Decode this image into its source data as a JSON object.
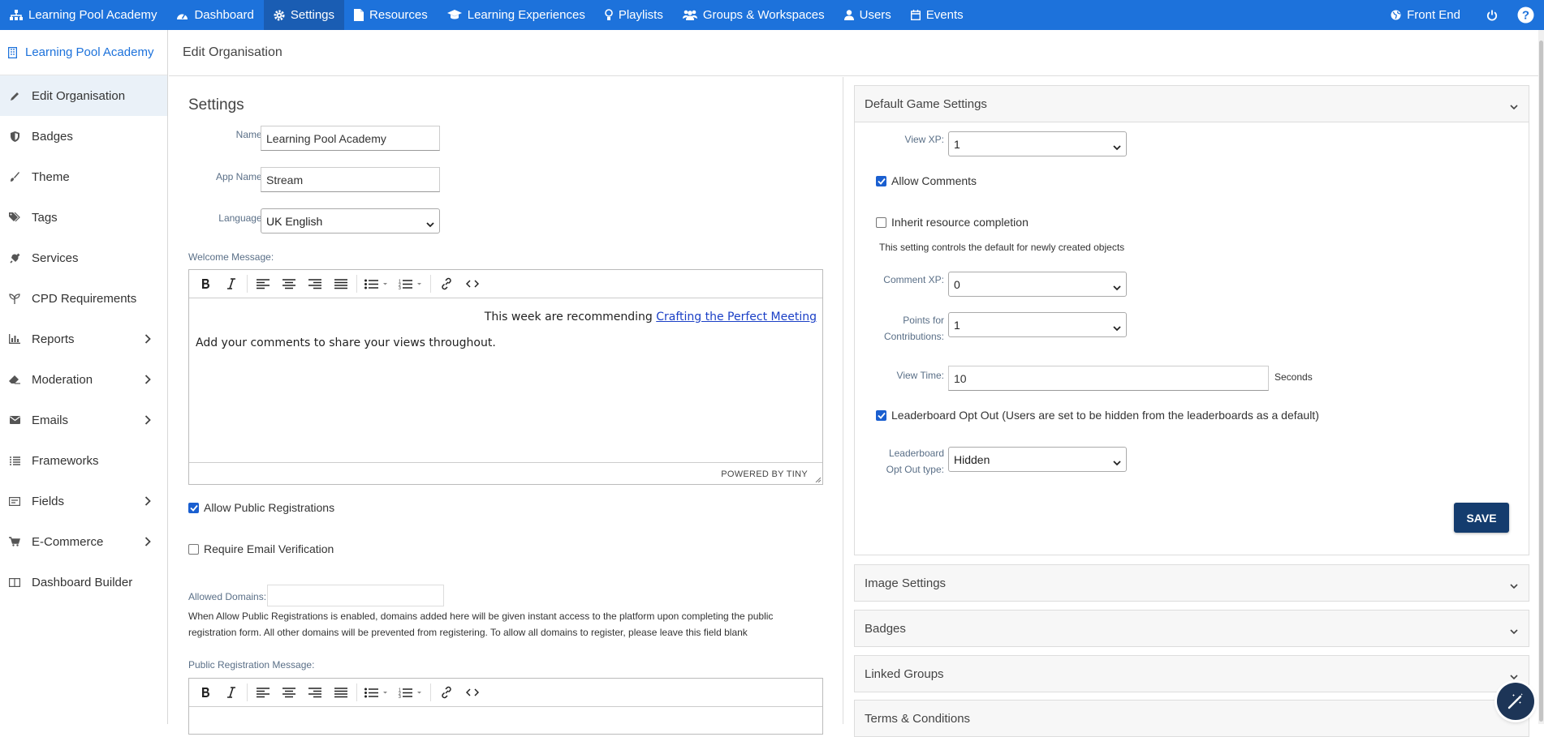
{
  "topnav": {
    "items": [
      {
        "label": "Learning Pool Academy",
        "icon": "sitemap-icon"
      },
      {
        "label": "Dashboard",
        "icon": "dashboard-icon"
      },
      {
        "label": "Settings",
        "icon": "gear-icon"
      },
      {
        "label": "Resources",
        "icon": "file-icon"
      },
      {
        "label": "Learning Experiences",
        "icon": "graduation-cap-icon"
      },
      {
        "label": "Playlists",
        "icon": "lightbulb-icon"
      },
      {
        "label": "Groups & Workspaces",
        "icon": "users-icon"
      },
      {
        "label": "Users",
        "icon": "user-icon"
      },
      {
        "label": "Events",
        "icon": "calendar-icon"
      }
    ],
    "front_end": "Front End",
    "active_color": "#1a5db3",
    "bar_color": "#1d72db"
  },
  "sidebar": {
    "org": "Learning Pool Academy",
    "items": [
      {
        "label": "Edit Organisation",
        "icon": "pencil-icon"
      },
      {
        "label": "Badges",
        "icon": "shield-icon"
      },
      {
        "label": "Theme",
        "icon": "brush-icon"
      },
      {
        "label": "Tags",
        "icon": "tags-icon"
      },
      {
        "label": "Services",
        "icon": "plug-icon"
      },
      {
        "label": "CPD Requirements",
        "icon": "seedling-icon"
      },
      {
        "label": "Reports",
        "icon": "bar-chart-icon"
      },
      {
        "label": "Moderation",
        "icon": "eraser-icon"
      },
      {
        "label": "Emails",
        "icon": "envelope-icon"
      },
      {
        "label": "Frameworks",
        "icon": "list-icon"
      },
      {
        "label": "Fields",
        "icon": "form-icon"
      },
      {
        "label": "E-Commerce",
        "icon": "cart-icon"
      },
      {
        "label": "Dashboard Builder",
        "icon": "columns-icon"
      }
    ]
  },
  "header": {
    "title": "Edit Organisation"
  },
  "settings": {
    "title": "Settings",
    "name_label": "Name:",
    "name_value": "Learning Pool Academy",
    "app_name_label": "App Name:",
    "app_name_value": "Stream",
    "language_label": "Language:",
    "language_value": "UK English",
    "welcome_label": "Welcome Message:",
    "welcome_line1_prefix": "This week are recommending ",
    "welcome_line1_link": "Crafting the Perfect Meeting",
    "welcome_line2": "Add your comments to share your views throughout.",
    "powered_by": "POWERED BY TINY",
    "allow_public_registrations": "Allow Public Registrations",
    "require_email_verification": "Require Email Verification",
    "allowed_domains_label": "Allowed Domains:",
    "allowed_domains_value": "",
    "domains_help_1": "When Allow Public Registrations is enabled, domains added here will be given instant access to the platform upon completing the public",
    "domains_help_2": "registration form. All other domains will be prevented from registering. To allow all domains to register, please leave this field blank",
    "public_reg_label": "Public Registration Message:"
  },
  "game_settings": {
    "title": "Default Game Settings",
    "view_xp_label": "View XP:",
    "view_xp_value": "1",
    "allow_comments": "Allow Comments",
    "inherit_completion": "Inherit resource completion",
    "inherit_help": "This setting controls the default for newly created objects",
    "comment_xp_label": "Comment XP:",
    "comment_xp_value": "0",
    "points_label_1": "Points for",
    "points_label_2": "Contributions:",
    "points_value": "1",
    "view_time_label": "View Time:",
    "view_time_value": "10",
    "seconds": "Seconds",
    "leaderboard_opt_out": "Leaderboard Opt Out (Users are set to be hidden from the leaderboards as a default)",
    "opt_out_type_label_1": "Leaderboard",
    "opt_out_type_label_2": "Opt Out type:",
    "opt_out_type_value": "Hidden",
    "save": "SAVE"
  },
  "panels": {
    "image_settings": "Image Settings",
    "badges": "Badges",
    "linked_groups": "Linked Groups",
    "terms": "Terms & Conditions"
  }
}
